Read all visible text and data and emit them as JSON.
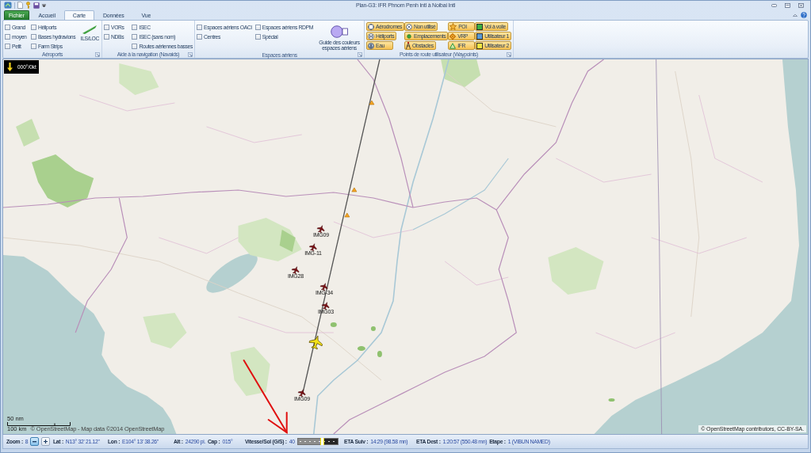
{
  "window": {
    "title": "Plan-G3: IFR Phnom Penh Intl à Noibai Intl"
  },
  "ribbon": {
    "tabs": [
      {
        "label": "Fichier",
        "kind": "file",
        "selected": false
      },
      {
        "label": "Accueil",
        "kind": "tab",
        "selected": false
      },
      {
        "label": "Carte",
        "kind": "tab",
        "selected": true
      },
      {
        "label": "Données",
        "kind": "tab",
        "selected": false
      },
      {
        "label": "Vue",
        "kind": "tab",
        "selected": false
      }
    ],
    "groups": [
      {
        "label": "Aéroports",
        "columns": [
          [
            {
              "kind": "checkbox",
              "label": "Grand",
              "checked": false
            },
            {
              "kind": "checkbox",
              "label": "moyen",
              "checked": false
            },
            {
              "kind": "checkbox",
              "label": "Petit",
              "checked": false
            }
          ],
          [
            {
              "kind": "checkbox",
              "label": "Héliports",
              "checked": false
            },
            {
              "kind": "checkbox",
              "label": "Bases hydravions",
              "checked": false
            },
            {
              "kind": "checkbox",
              "label": "Farm Strips",
              "checked": false
            }
          ],
          [
            {
              "kind": "large",
              "label": "ILS/LOC"
            }
          ]
        ]
      },
      {
        "label": "Aide à la navigation (Navaids)",
        "columns": [
          [
            {
              "kind": "checkbox",
              "label": "VORs",
              "checked": false
            },
            {
              "kind": "checkbox",
              "label": "NDBs",
              "checked": false
            }
          ],
          [
            {
              "kind": "checkbox",
              "label": "ISEC",
              "checked": false
            },
            {
              "kind": "checkbox",
              "label": "ISEC (sans nom)",
              "checked": false
            },
            {
              "kind": "checkbox",
              "label": "Routes aériennes basses",
              "checked": false
            }
          ]
        ]
      },
      {
        "label": "Espaces aériens",
        "columns": [
          [
            {
              "kind": "checkbox",
              "label": "Espaces aériens OACI",
              "checked": false
            },
            {
              "kind": "checkbox",
              "label": "Centres",
              "checked": false
            }
          ],
          [
            {
              "kind": "checkbox",
              "label": "Espaces aériens RDPM",
              "checked": false
            },
            {
              "kind": "checkbox",
              "label": "Spécial",
              "checked": false
            }
          ],
          [
            {
              "kind": "large",
              "label": "Guide des couleurs espaces aériens"
            }
          ]
        ]
      },
      {
        "label": "Points de route utilisateur (Waypoints)",
        "columns": [
          [
            {
              "kind": "toggle",
              "label": "Aérodromes",
              "checked": true
            },
            {
              "kind": "toggle",
              "label": "Héliports",
              "checked": true
            },
            {
              "kind": "toggle",
              "label": "Eau",
              "checked": true
            }
          ],
          [
            {
              "kind": "toggle",
              "label": "Non utilisé",
              "checked": true
            },
            {
              "kind": "toggle",
              "label": "Emplacements",
              "checked": true
            },
            {
              "kind": "toggle",
              "label": "Obstacles",
              "checked": true
            }
          ],
          [
            {
              "kind": "toggle",
              "label": "POI",
              "checked": true
            },
            {
              "kind": "toggle",
              "label": "VRP",
              "checked": true
            },
            {
              "kind": "toggle",
              "label": "IFR",
              "checked": true
            }
          ],
          [
            {
              "kind": "toggle",
              "label": "Vol à voile",
              "checked": true
            },
            {
              "kind": "toggle",
              "label": "Utilisateur 1",
              "checked": true
            },
            {
              "kind": "toggle",
              "label": "Utilisateur 2",
              "checked": true
            }
          ]
        ]
      }
    ]
  },
  "map": {
    "wind": "000°/0kt",
    "waypoints": [
      {
        "label": "IMG09"
      },
      {
        "label": "IMG-11"
      },
      {
        "label": "IMG28"
      },
      {
        "label": "IMG-34"
      },
      {
        "label": "IMG03"
      },
      {
        "label": "IMG09"
      }
    ],
    "scale": {
      "nm": "50 nm",
      "km": "100 km"
    },
    "attribution_left": "© OpenStreetMap - Map data ©2014 OpenStreetMap",
    "attribution_right": "© OpenStreetMap contributors, CC-BY-SA."
  },
  "status_bar": {
    "items": [
      {
        "kind": "zoom",
        "label": "Zoom :",
        "value": "8",
        "buttons": [
          {
            "kind": "minus",
            "highlighted": true
          },
          {
            "kind": "plus",
            "highlighted": false
          }
        ]
      },
      {
        "kind": "field",
        "label": "Lat :",
        "value": "N13° 32' 21.12\""
      },
      {
        "kind": "field",
        "label": "Lon :",
        "value": "E104° 13' 38.26\""
      },
      {
        "kind": "field",
        "label": "Alt :",
        "value": "24290 pi."
      },
      {
        "kind": "field",
        "label": "Cap :",
        "value": "015°"
      },
      {
        "kind": "speed",
        "label": "Vitesse/Sol (G/S) :",
        "value": "40",
        "level": 0.6
      },
      {
        "kind": "field",
        "label": "ETA Suiv :",
        "value": "14:29 (98.58 mn)"
      },
      {
        "kind": "field",
        "label": "ETA Dest :",
        "value": "1:20:57 (550.48 mn)"
      },
      {
        "kind": "field",
        "label": "Etape :",
        "value": "1 (VIBUN NAMED)"
      }
    ]
  }
}
